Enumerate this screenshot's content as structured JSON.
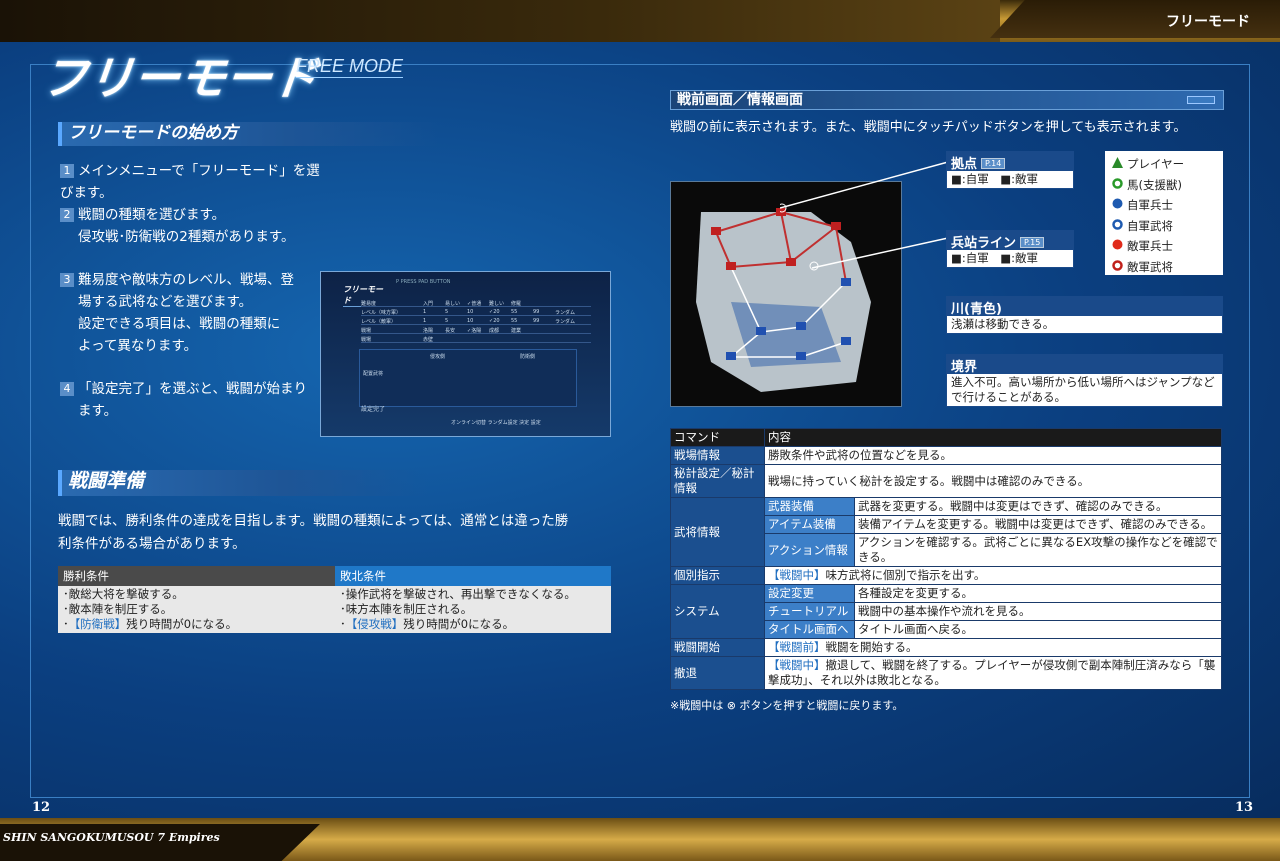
{
  "header": {
    "right_label": "フリーモード"
  },
  "footer": {
    "game_title": "SHIN SANGOKUMUSOU 7 Empires",
    "page_left": "12",
    "page_right": "13"
  },
  "page_title": "フリーモード",
  "page_subtitle": "FREE MODE",
  "sec1": {
    "title": "フリーモードの始め方",
    "steps": [
      {
        "n": "1",
        "lines": [
          "メインメニューで「フリーモード」を選びます。"
        ]
      },
      {
        "n": "2",
        "lines": [
          "戦闘の種類を選びます。",
          "侵攻戦･防衛戦の2種類があります。"
        ]
      },
      {
        "n": "3",
        "lines": [
          "難易度や敵味方のレベル、戦場、登",
          "場する武将などを選びます。",
          "設定できる項目は、戦闘の種類に",
          "よって異なります。"
        ]
      },
      {
        "n": "4",
        "lines": [
          "「設定完了」を選ぶと、戦闘が始まり",
          "ます。"
        ]
      }
    ]
  },
  "screenshot": {
    "title": "フリーモード",
    "press": "P PRESS PAD BUTTON",
    "setting_done": "設定完了",
    "hint": "オンライン切替  ランダム設定  決定  設定",
    "rows": [
      [
        "難易度",
        "入門",
        "易しい",
        "✓普通",
        "難しい",
        "修羅"
      ],
      [
        "レベル（味方軍）",
        "1",
        "5",
        "10",
        "✓20",
        "55",
        "99",
        "ランダム"
      ],
      [
        "レベル（敵軍）",
        "1",
        "5",
        "10",
        "✓20",
        "55",
        "99",
        "ランダム"
      ],
      [
        "戦場",
        "洛陽",
        "長安",
        "✓洛陽",
        "成都",
        "建業"
      ],
      [
        "戦場",
        "赤壁"
      ]
    ],
    "left_header": "配置武将",
    "team_a": "侵攻側",
    "team_b": "防衛側"
  },
  "sec2": {
    "title": "戦闘準備",
    "text": [
      "戦闘では、勝利条件の達成を目指します。戦闘の種類によっては、通常とは違った勝",
      "利条件がある場合があります。"
    ],
    "win_header": "勝利条件",
    "lose_header": "敗北条件",
    "win": [
      "･敵総大将を撃破する。",
      "･敵本陣を制圧する。",
      {
        "tag": "【防衛戦】",
        "text": "残り時間が0になる。"
      }
    ],
    "lose": [
      "･操作武将を撃破され、再出撃できなくなる。",
      "･味方本陣を制圧される。",
      {
        "tag": "【侵攻戦】",
        "text": "残り時間が0になる。"
      }
    ]
  },
  "right": {
    "title": "戦前画面／情報画面",
    "intro": "戦闘の前に表示されます。また、戦闘中にタッチパッドボタンを押しても表示されます。",
    "kyoten": {
      "title": "拠点",
      "ref": "P.14",
      "body": "■:自軍　■:敵軍"
    },
    "heitan": {
      "title": "兵站ライン",
      "ref": "P.15",
      "body": "■:自軍　■:敵軍"
    },
    "river": {
      "title": "川(青色)",
      "body": "浅瀬は移動できる。"
    },
    "border": {
      "title": "境界",
      "body": [
        "進入不可。高い場所から低い場所へはジャンプなど",
        "で行けることがある。"
      ]
    },
    "legend": [
      {
        "label": "プレイヤー",
        "color": "#2a8a2a",
        "icon": "triangle"
      },
      {
        "label": "馬(支援獣)",
        "color": "#2a9a2a",
        "icon": "ring"
      },
      {
        "label": "自軍兵士",
        "color": "#1e5ab0",
        "icon": "dot"
      },
      {
        "label": "自軍武将",
        "color": "#1e5ab0",
        "icon": "ring"
      },
      {
        "label": "敵軍兵士",
        "color": "#e02a1a",
        "icon": "dot"
      },
      {
        "label": "敵軍武将",
        "color": "#c0201a",
        "icon": "ring"
      }
    ],
    "commands": {
      "h1": "コマンド",
      "h2": "内容",
      "rows": [
        {
          "k": "戦場情報",
          "v": "勝敗条件や武将の位置などを見る。"
        },
        {
          "k": "秘計設定／秘計情報",
          "v": "戦場に持っていく秘計を設定する。戦闘中は確認のみできる。"
        },
        {
          "k": "武将情報",
          "subs": [
            {
              "s": "武器装備",
              "v": "武器を変更する。戦闘中は変更はできず、確認のみできる。"
            },
            {
              "s": "アイテム装備",
              "v": "装備アイテムを変更する。戦闘中は変更はできず、確認のみできる。"
            },
            {
              "s": "アクション情報",
              "v": "アクションを確認する。武将ごとに異なるEX攻撃の操作などを確認できる。"
            }
          ]
        },
        {
          "k": "個別指示",
          "tag": "【戦闘中】",
          "v": "味方武将に個別で指示を出す。"
        },
        {
          "k": "システム",
          "subs": [
            {
              "s": "設定変更",
              "v": "各種設定を変更する。"
            },
            {
              "s": "チュートリアル",
              "v": "戦闘中の基本操作や流れを見る。"
            },
            {
              "s": "タイトル画面へ",
              "v": "タイトル画面へ戻る。"
            }
          ]
        },
        {
          "k": "戦闘開始",
          "tag": "【戦闘前】",
          "v": "戦闘を開始する。"
        },
        {
          "k": "撤退",
          "tag": "【戦闘中】",
          "v": "撤退して、戦闘を終了する。プレイヤーが侵攻側で副本陣制圧済みなら「襲撃成功」、それ以外は敗北となる。"
        }
      ]
    },
    "note": "※戦闘中は ⊗ ボタンを押すと戦闘に戻ります。"
  }
}
